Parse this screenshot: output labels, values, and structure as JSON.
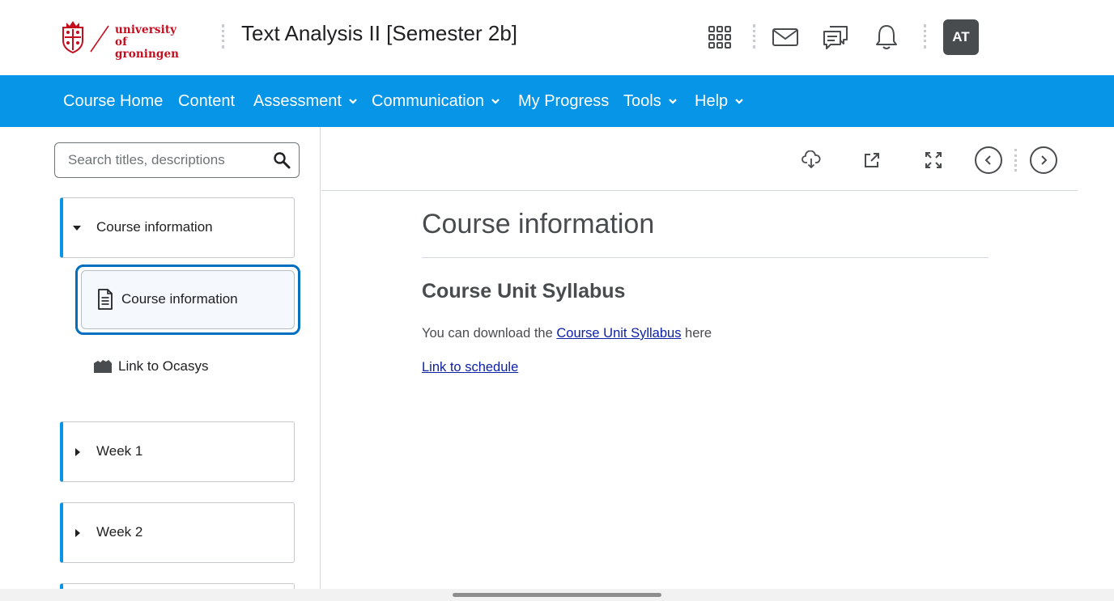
{
  "header": {
    "logo_text_line1": "university of",
    "logo_text_line2": "groningen",
    "course_title": "Text Analysis II [Semester 2b]",
    "icons": [
      "apps-grid-icon",
      "mail-icon",
      "chat-icon",
      "bell-icon"
    ],
    "avatar_initials": "AT"
  },
  "nav": {
    "items": [
      {
        "label": "Course Home",
        "dropdown": false
      },
      {
        "label": "Content",
        "dropdown": false
      },
      {
        "label": "Assessment",
        "dropdown": true
      },
      {
        "label": "Communication",
        "dropdown": true
      },
      {
        "label": "My Progress",
        "dropdown": false
      },
      {
        "label": "Tools",
        "dropdown": true
      },
      {
        "label": "Help",
        "dropdown": true
      }
    ]
  },
  "sidebar": {
    "search_placeholder": "Search titles, descriptions",
    "modules": [
      {
        "label": "Course information",
        "expanded": true
      },
      {
        "label": "Week 1",
        "expanded": false
      },
      {
        "label": "Week 2",
        "expanded": false
      }
    ],
    "topics": [
      {
        "label": "Course information",
        "selected": true,
        "icon": "document-icon"
      },
      {
        "label": "Link to Ocasys",
        "selected": false,
        "icon": "link-icon"
      }
    ]
  },
  "content": {
    "toolbar_icons": [
      "download-icon",
      "open-external-icon",
      "fullscreen-icon",
      "previous-icon",
      "next-icon"
    ],
    "title": "Course information",
    "heading": "Course Unit Syllabus",
    "para_prefix": "You can download the ",
    "para_link": "Course Unit Syllabus",
    "para_suffix": " here",
    "schedule_link": "Link to schedule"
  },
  "colors": {
    "nav_blue": "#0795e7",
    "brand_red": "#c40d1e",
    "link_blue": "#0c1fa6",
    "selected_border": "#006fbf",
    "avatar_bg": "#494c4e"
  }
}
